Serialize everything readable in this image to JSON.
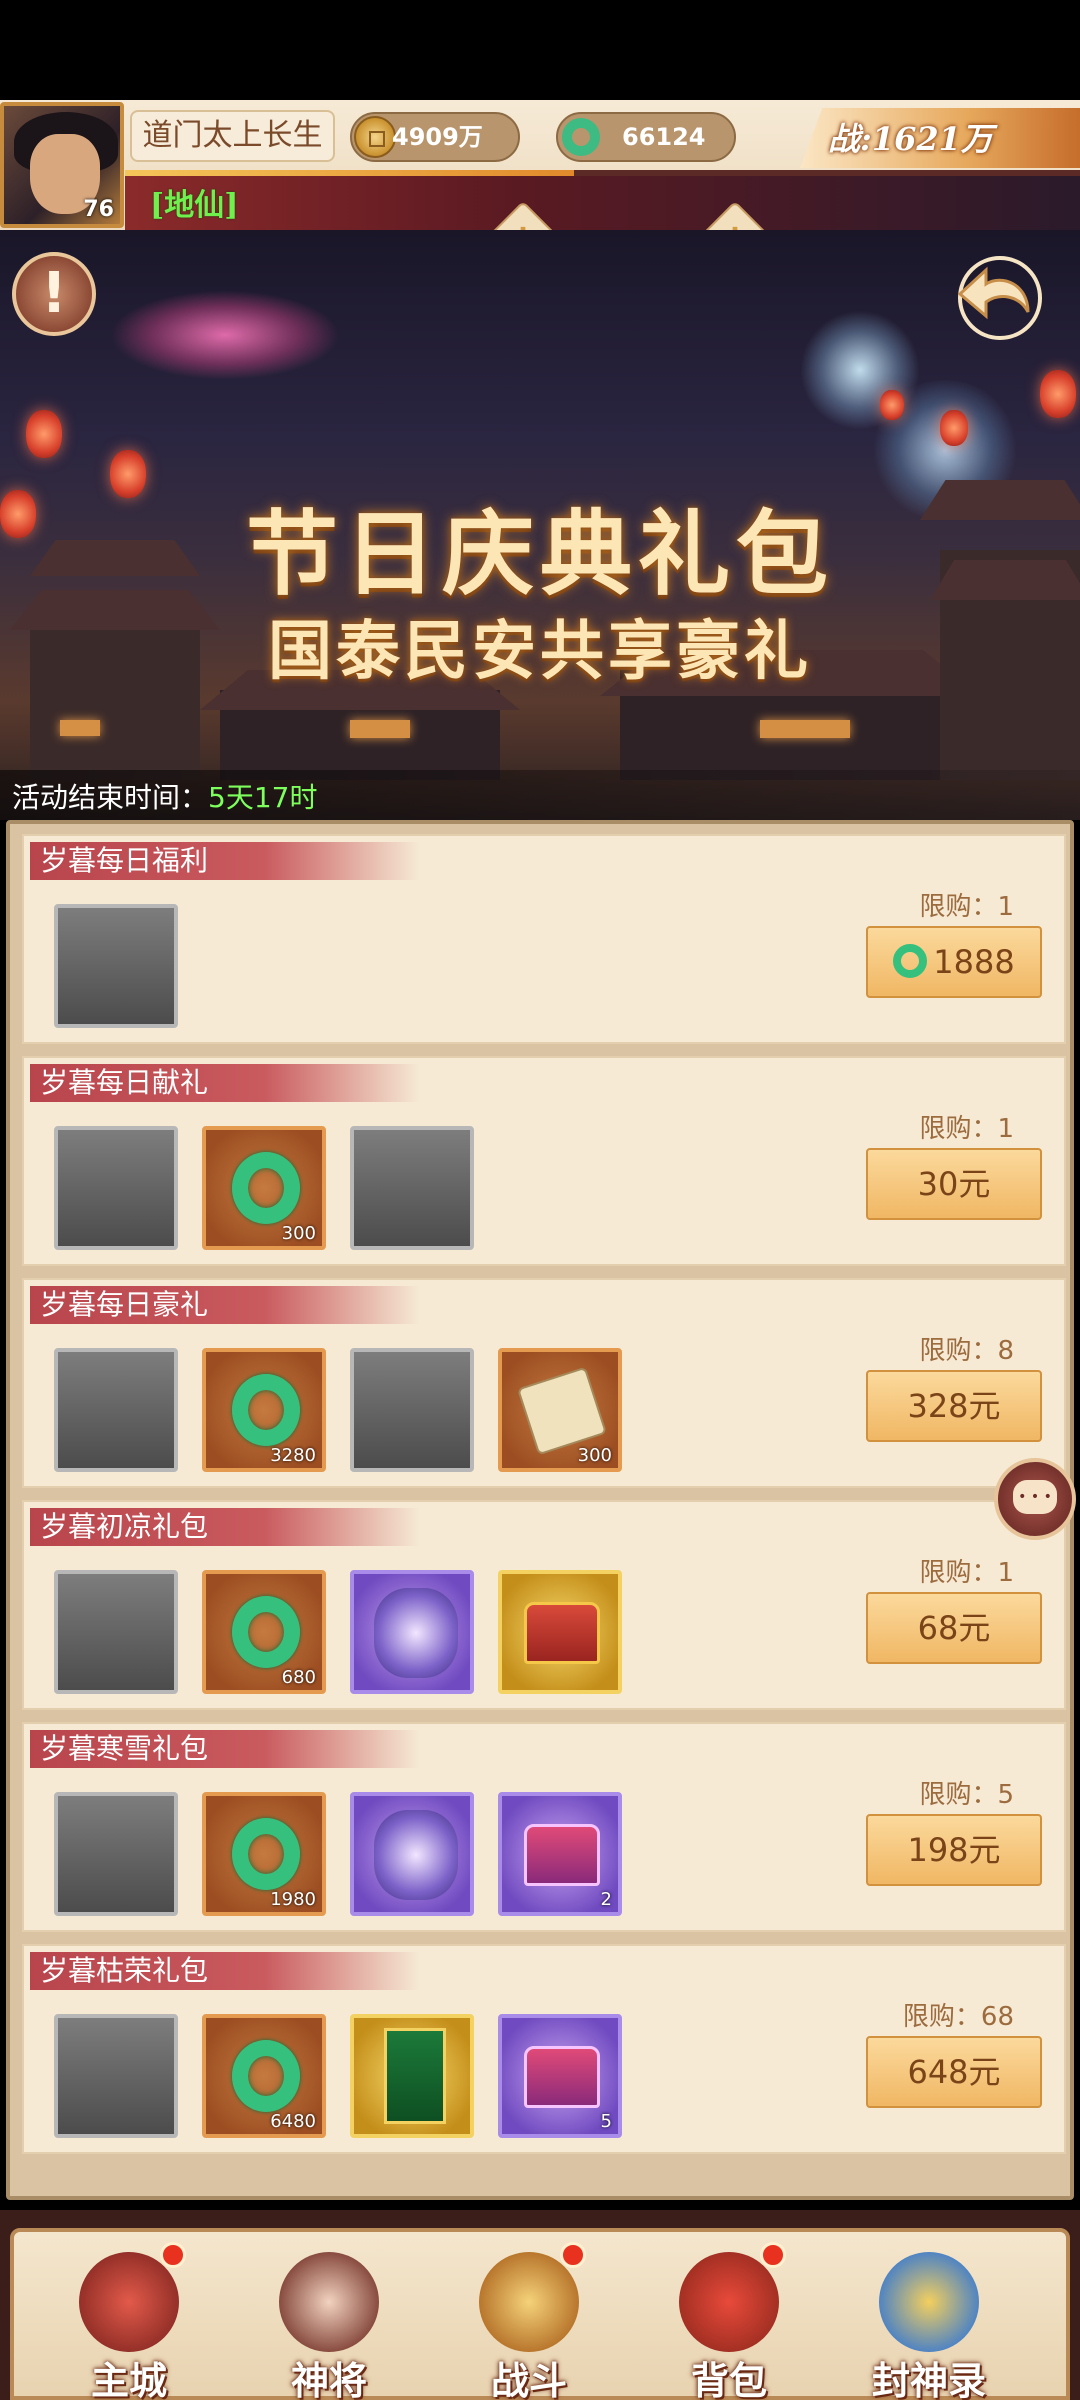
{
  "player": {
    "name": "道门太上长生",
    "level": "76",
    "rank": "[地仙]",
    "coins": "4909万",
    "jade": "66124",
    "power": "战:1621万",
    "exp_progress": 0.47
  },
  "banner": {
    "title": "节日庆典礼包",
    "subtitle": "国泰民安共享豪礼",
    "timer_label": "活动结束时间：",
    "timer_value": "5天17时"
  },
  "packs": [
    {
      "title": "岁暮每日福利",
      "limit": "限购：1",
      "price": "1888",
      "price_uses_jade": true,
      "items": [
        {
          "type": "empty"
        }
      ]
    },
    {
      "title": "岁暮每日献礼",
      "limit": "限购：1",
      "price": "30元",
      "items": [
        {
          "type": "empty"
        },
        {
          "type": "jade",
          "qty": "300"
        },
        {
          "type": "empty"
        }
      ]
    },
    {
      "title": "岁暮每日豪礼",
      "limit": "限购：8",
      "price": "328元",
      "items": [
        {
          "type": "empty"
        },
        {
          "type": "jade",
          "qty": "3280"
        },
        {
          "type": "empty"
        },
        {
          "type": "scroll",
          "qty": "300"
        }
      ]
    },
    {
      "title": "岁暮初凉礼包",
      "limit": "限购：1",
      "price": "68元",
      "items": [
        {
          "type": "empty"
        },
        {
          "type": "jade",
          "qty": "680"
        },
        {
          "type": "hero"
        },
        {
          "type": "gold-chest"
        }
      ]
    },
    {
      "title": "岁暮寒雪礼包",
      "limit": "限购：5",
      "price": "198元",
      "items": [
        {
          "type": "empty"
        },
        {
          "type": "jade",
          "qty": "1980"
        },
        {
          "type": "hero"
        },
        {
          "type": "purple-chest",
          "qty": "2"
        }
      ]
    },
    {
      "title": "岁暮枯荣礼包",
      "limit": "限购：68",
      "price": "648元",
      "items": [
        {
          "type": "empty"
        },
        {
          "type": "jade",
          "qty": "6480"
        },
        {
          "type": "banner-item"
        },
        {
          "type": "purple-chest",
          "qty": "5"
        }
      ]
    }
  ],
  "nav": [
    {
      "label": "主城",
      "icon": "city-icon",
      "badge": true
    },
    {
      "label": "神将",
      "icon": "hero-icon",
      "badge": false
    },
    {
      "label": "战斗",
      "icon": "battle-icon",
      "badge": true
    },
    {
      "label": "背包",
      "icon": "bag-icon",
      "badge": true
    },
    {
      "label": "封神录",
      "icon": "record-icon",
      "badge": false
    }
  ],
  "colors": {
    "accent_red": "#b8454c",
    "price_button": "#f0b764",
    "timer_green": "#7dff5c",
    "rank_green": "#6ff04d"
  }
}
